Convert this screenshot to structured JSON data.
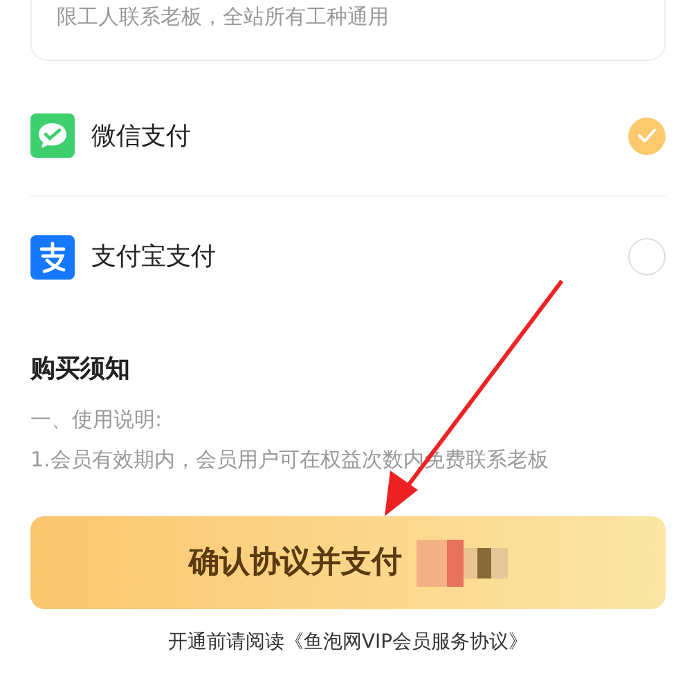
{
  "card_text": "限工人联系老板，全站所有工种通用",
  "payment_methods": [
    {
      "kind": "wechat",
      "label": "微信支付",
      "selected": true
    },
    {
      "kind": "alipay",
      "label": "支付宝支付",
      "selected": false
    }
  ],
  "notice": {
    "title": "购买须知",
    "lines": [
      "一、使用说明:",
      "1.会员有效期内，会员用户可在权益次数内免费联系老板"
    ]
  },
  "pay_button": {
    "label": "确认协议并支付"
  },
  "agreement": {
    "prefix": "开通前请阅读",
    "link": "《鱼泡网VIP会员服务协议》"
  }
}
